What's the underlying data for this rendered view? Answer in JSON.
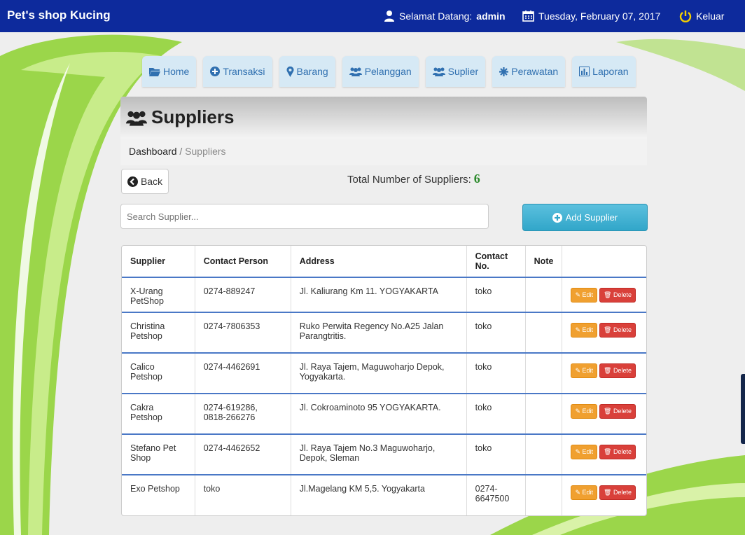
{
  "topbar": {
    "brand": "Pet's shop Kucing",
    "welcome_prefix": "Selamat Datang:",
    "user": "admin",
    "date": "Tuesday, February 07, 2017",
    "logout": "Keluar"
  },
  "nav": [
    {
      "label": "Home",
      "icon": "folder-open-icon"
    },
    {
      "label": "Transaksi",
      "icon": "plus-circle-icon"
    },
    {
      "label": "Barang",
      "icon": "map-marker-icon"
    },
    {
      "label": "Pelanggan",
      "icon": "users-icon"
    },
    {
      "label": "Suplier",
      "icon": "users-icon"
    },
    {
      "label": "Perawatan",
      "icon": "asterisk-icon"
    },
    {
      "label": "Laporan",
      "icon": "bar-chart-icon"
    }
  ],
  "page": {
    "title": "Suppliers",
    "breadcrumb_root": "Dashboard",
    "breadcrumb_sep": "/",
    "breadcrumb_current": "Suppliers",
    "back_label": "Back",
    "total_label": "Total Number of Suppliers:",
    "total_count": "6",
    "search_placeholder": "Search Supplier...",
    "add_label": "Add Supplier"
  },
  "table": {
    "columns": [
      "Supplier",
      "Contact Person",
      "Address",
      "Contact No.",
      "Note",
      ""
    ],
    "edit_label": "Edit",
    "delete_label": "Delete",
    "rows": [
      {
        "supplier": "X-Urang PetShop",
        "contact_person": "0274-889247",
        "address": "Jl. Kaliurang Km 11. YOGYAKARTA",
        "contact_no": "toko",
        "note": ""
      },
      {
        "supplier": "Christina Petshop",
        "contact_person": "0274-7806353",
        "address": "Ruko Perwita Regency No.A25 Jalan Parangtritis.",
        "contact_no": "toko",
        "note": ""
      },
      {
        "supplier": "Calico Petshop",
        "contact_person": "0274-4462691",
        "address": "Jl. Raya Tajem, Maguwoharjo Depok, Yogyakarta.",
        "contact_no": "toko",
        "note": ""
      },
      {
        "supplier": "Cakra Petshop",
        "contact_person": "0274-619286, 0818-266276",
        "address": "Jl. Cokroaminoto 95 YOGYAKARTA.",
        "contact_no": "toko",
        "note": ""
      },
      {
        "supplier": "Stefano Pet Shop",
        "contact_person": "0274-4462652",
        "address": "Jl. Raya Tajem No.3 Maguwoharjo, Depok, Sleman",
        "contact_no": "toko",
        "note": ""
      },
      {
        "supplier": "Exo Petshop",
        "contact_person": "toko",
        "address": "Jl.Magelang KM 5,5. Yogyakarta",
        "contact_no": "0274-6647500",
        "note": ""
      }
    ]
  },
  "colors": {
    "topbar": "#0d2a9c",
    "accent_green": "#2b8a2b",
    "add_button": "#5bc0de",
    "edit_button": "#f0a030",
    "delete_button": "#d9403a"
  }
}
